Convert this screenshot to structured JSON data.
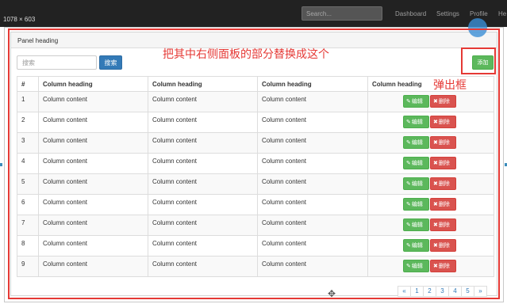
{
  "window": {
    "dimensions_label": "1078 × 603"
  },
  "navbar": {
    "search_placeholder": "Search...",
    "links": [
      "Dashboard",
      "Settings",
      "Profile",
      "He"
    ]
  },
  "panel": {
    "heading": "Panel heading"
  },
  "toolbar": {
    "search_placeholder": "搜索",
    "search_label": "搜索",
    "add_label": "添加"
  },
  "annotations": {
    "main": "把其中右侧面板的部分替换成这个",
    "popup": "弹出框"
  },
  "table": {
    "headers": [
      "#",
      "Column heading",
      "Column heading",
      "Column heading",
      "Column heading"
    ],
    "edit_label": "编辑",
    "delete_label": "删除",
    "rows": [
      {
        "id": "1",
        "c1": "Column content",
        "c2": "Column content",
        "c3": "Column content"
      },
      {
        "id": "2",
        "c1": "Column content",
        "c2": "Column content",
        "c3": "Column content"
      },
      {
        "id": "3",
        "c1": "Column content",
        "c2": "Column content",
        "c3": "Column content"
      },
      {
        "id": "4",
        "c1": "Column content",
        "c2": "Column content",
        "c3": "Column content"
      },
      {
        "id": "5",
        "c1": "Column content",
        "c2": "Column content",
        "c3": "Column content"
      },
      {
        "id": "6",
        "c1": "Column content",
        "c2": "Column content",
        "c3": "Column content"
      },
      {
        "id": "7",
        "c1": "Column content",
        "c2": "Column content",
        "c3": "Column content"
      },
      {
        "id": "8",
        "c1": "Column content",
        "c2": "Column content",
        "c3": "Column content"
      },
      {
        "id": "9",
        "c1": "Column content",
        "c2": "Column content",
        "c3": "Column content"
      }
    ]
  },
  "pagination": {
    "prev": "«",
    "pages": [
      "1",
      "2",
      "3",
      "4",
      "5"
    ],
    "next": "»"
  },
  "icons": {
    "edit": "pencil-icon",
    "delete": "times-icon",
    "move": "move-cursor-icon"
  },
  "colors": {
    "annotation_red": "#e53935",
    "primary_blue": "#337ab7",
    "success_green": "#5cb85c",
    "danger_red": "#d9534f"
  }
}
